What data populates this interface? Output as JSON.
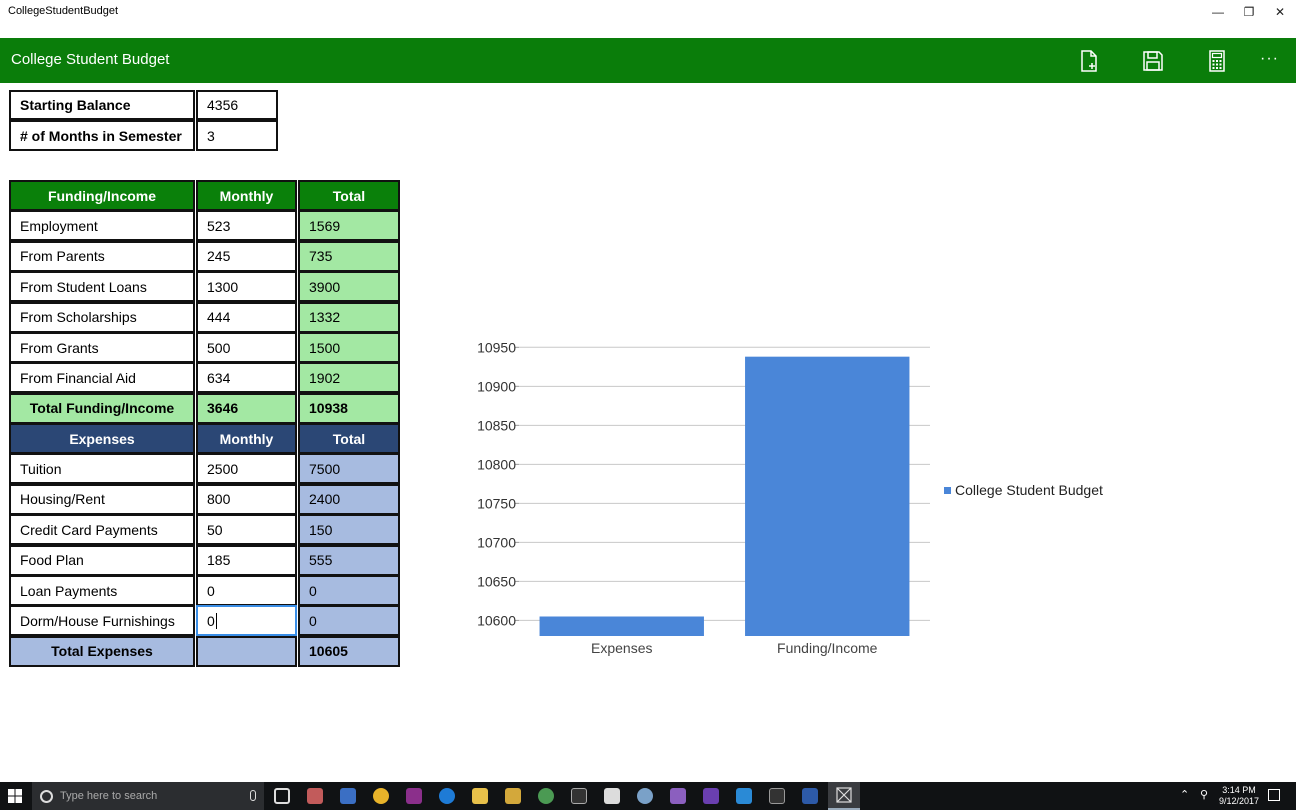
{
  "window": {
    "title": "CollegeStudentBudget",
    "controls": {
      "minimize": "—",
      "restore": "❐",
      "close": "✕"
    }
  },
  "appbar": {
    "title": "College Student Budget",
    "icons": [
      "new-document-icon",
      "save-icon",
      "calculator-icon",
      "more-icon"
    ],
    "more_label": "···"
  },
  "setup": [
    {
      "label": "Starting Balance",
      "value": "4356"
    },
    {
      "label": "# of Months in Semester",
      "value": "3"
    }
  ],
  "income": {
    "header": {
      "label": "Funding/Income",
      "monthly": "Monthly",
      "total": "Total"
    },
    "rows": [
      {
        "label": "Employment",
        "monthly": "523",
        "total": "1569"
      },
      {
        "label": "From Parents",
        "monthly": "245",
        "total": "735"
      },
      {
        "label": "From Student Loans",
        "monthly": "1300",
        "total": "3900"
      },
      {
        "label": "From Scholarships",
        "monthly": "444",
        "total": "1332"
      },
      {
        "label": "From Grants",
        "monthly": "500",
        "total": "1500"
      },
      {
        "label": "From Financial Aid",
        "monthly": "634",
        "total": "1902"
      }
    ],
    "totals": {
      "label": "Total Funding/Income",
      "monthly": "3646",
      "total": "10938"
    }
  },
  "expenses": {
    "header": {
      "label": "Expenses",
      "monthly": "Monthly",
      "total": "Total"
    },
    "rows": [
      {
        "label": "Tuition",
        "monthly": "2500",
        "total": "7500"
      },
      {
        "label": "Housing/Rent",
        "monthly": "800",
        "total": "2400"
      },
      {
        "label": "Credit Card Payments",
        "monthly": "50",
        "total": "150"
      },
      {
        "label": "Food Plan",
        "monthly": "185",
        "total": "555"
      },
      {
        "label": "Loan Payments",
        "monthly": "0",
        "total": "0"
      },
      {
        "label": "Dorm/House Furnishings",
        "monthly": "0",
        "total": "0"
      }
    ],
    "totals": {
      "label": "Total Expenses",
      "monthly": "",
      "total": "10605"
    }
  },
  "chart_data": {
    "type": "bar",
    "categories": [
      "Expenses",
      "Funding/Income"
    ],
    "series": [
      {
        "name": "College Student Budget",
        "values": [
          10605,
          10938
        ]
      }
    ],
    "ylim": [
      10580,
      10985
    ],
    "yticks": [
      10600,
      10650,
      10700,
      10750,
      10800,
      10850,
      10900,
      10950
    ],
    "legend": "right",
    "grid": true,
    "color": "#4a86d8"
  },
  "taskbar": {
    "search_placeholder": "Type here to search",
    "time": "3:14 PM",
    "date": "9/12/2017"
  }
}
